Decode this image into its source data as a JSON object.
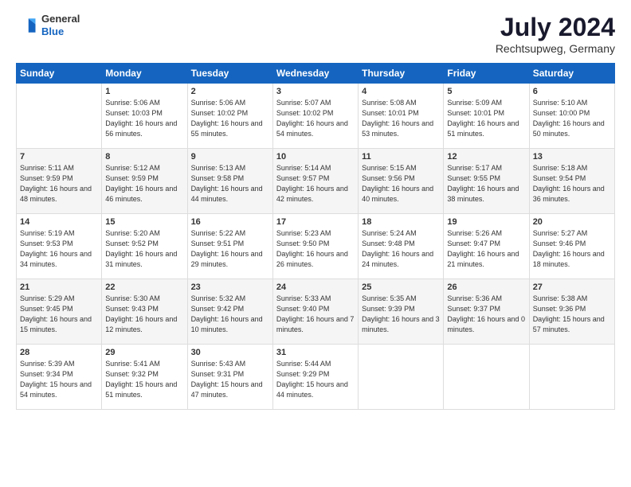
{
  "header": {
    "logo_general": "General",
    "logo_blue": "Blue",
    "month_title": "July 2024",
    "location": "Rechtsupweg, Germany"
  },
  "weekdays": [
    "Sunday",
    "Monday",
    "Tuesday",
    "Wednesday",
    "Thursday",
    "Friday",
    "Saturday"
  ],
  "weeks": [
    [
      {
        "day": "",
        "sunrise": "",
        "sunset": "",
        "daylight": ""
      },
      {
        "day": "1",
        "sunrise": "Sunrise: 5:06 AM",
        "sunset": "Sunset: 10:03 PM",
        "daylight": "Daylight: 16 hours and 56 minutes."
      },
      {
        "day": "2",
        "sunrise": "Sunrise: 5:06 AM",
        "sunset": "Sunset: 10:02 PM",
        "daylight": "Daylight: 16 hours and 55 minutes."
      },
      {
        "day": "3",
        "sunrise": "Sunrise: 5:07 AM",
        "sunset": "Sunset: 10:02 PM",
        "daylight": "Daylight: 16 hours and 54 minutes."
      },
      {
        "day": "4",
        "sunrise": "Sunrise: 5:08 AM",
        "sunset": "Sunset: 10:01 PM",
        "daylight": "Daylight: 16 hours and 53 minutes."
      },
      {
        "day": "5",
        "sunrise": "Sunrise: 5:09 AM",
        "sunset": "Sunset: 10:01 PM",
        "daylight": "Daylight: 16 hours and 51 minutes."
      },
      {
        "day": "6",
        "sunrise": "Sunrise: 5:10 AM",
        "sunset": "Sunset: 10:00 PM",
        "daylight": "Daylight: 16 hours and 50 minutes."
      }
    ],
    [
      {
        "day": "7",
        "sunrise": "Sunrise: 5:11 AM",
        "sunset": "Sunset: 9:59 PM",
        "daylight": "Daylight: 16 hours and 48 minutes."
      },
      {
        "day": "8",
        "sunrise": "Sunrise: 5:12 AM",
        "sunset": "Sunset: 9:59 PM",
        "daylight": "Daylight: 16 hours and 46 minutes."
      },
      {
        "day": "9",
        "sunrise": "Sunrise: 5:13 AM",
        "sunset": "Sunset: 9:58 PM",
        "daylight": "Daylight: 16 hours and 44 minutes."
      },
      {
        "day": "10",
        "sunrise": "Sunrise: 5:14 AM",
        "sunset": "Sunset: 9:57 PM",
        "daylight": "Daylight: 16 hours and 42 minutes."
      },
      {
        "day": "11",
        "sunrise": "Sunrise: 5:15 AM",
        "sunset": "Sunset: 9:56 PM",
        "daylight": "Daylight: 16 hours and 40 minutes."
      },
      {
        "day": "12",
        "sunrise": "Sunrise: 5:17 AM",
        "sunset": "Sunset: 9:55 PM",
        "daylight": "Daylight: 16 hours and 38 minutes."
      },
      {
        "day": "13",
        "sunrise": "Sunrise: 5:18 AM",
        "sunset": "Sunset: 9:54 PM",
        "daylight": "Daylight: 16 hours and 36 minutes."
      }
    ],
    [
      {
        "day": "14",
        "sunrise": "Sunrise: 5:19 AM",
        "sunset": "Sunset: 9:53 PM",
        "daylight": "Daylight: 16 hours and 34 minutes."
      },
      {
        "day": "15",
        "sunrise": "Sunrise: 5:20 AM",
        "sunset": "Sunset: 9:52 PM",
        "daylight": "Daylight: 16 hours and 31 minutes."
      },
      {
        "day": "16",
        "sunrise": "Sunrise: 5:22 AM",
        "sunset": "Sunset: 9:51 PM",
        "daylight": "Daylight: 16 hours and 29 minutes."
      },
      {
        "day": "17",
        "sunrise": "Sunrise: 5:23 AM",
        "sunset": "Sunset: 9:50 PM",
        "daylight": "Daylight: 16 hours and 26 minutes."
      },
      {
        "day": "18",
        "sunrise": "Sunrise: 5:24 AM",
        "sunset": "Sunset: 9:48 PM",
        "daylight": "Daylight: 16 hours and 24 minutes."
      },
      {
        "day": "19",
        "sunrise": "Sunrise: 5:26 AM",
        "sunset": "Sunset: 9:47 PM",
        "daylight": "Daylight: 16 hours and 21 minutes."
      },
      {
        "day": "20",
        "sunrise": "Sunrise: 5:27 AM",
        "sunset": "Sunset: 9:46 PM",
        "daylight": "Daylight: 16 hours and 18 minutes."
      }
    ],
    [
      {
        "day": "21",
        "sunrise": "Sunrise: 5:29 AM",
        "sunset": "Sunset: 9:45 PM",
        "daylight": "Daylight: 16 hours and 15 minutes."
      },
      {
        "day": "22",
        "sunrise": "Sunrise: 5:30 AM",
        "sunset": "Sunset: 9:43 PM",
        "daylight": "Daylight: 16 hours and 12 minutes."
      },
      {
        "day": "23",
        "sunrise": "Sunrise: 5:32 AM",
        "sunset": "Sunset: 9:42 PM",
        "daylight": "Daylight: 16 hours and 10 minutes."
      },
      {
        "day": "24",
        "sunrise": "Sunrise: 5:33 AM",
        "sunset": "Sunset: 9:40 PM",
        "daylight": "Daylight: 16 hours and 7 minutes."
      },
      {
        "day": "25",
        "sunrise": "Sunrise: 5:35 AM",
        "sunset": "Sunset: 9:39 PM",
        "daylight": "Daylight: 16 hours and 3 minutes."
      },
      {
        "day": "26",
        "sunrise": "Sunrise: 5:36 AM",
        "sunset": "Sunset: 9:37 PM",
        "daylight": "Daylight: 16 hours and 0 minutes."
      },
      {
        "day": "27",
        "sunrise": "Sunrise: 5:38 AM",
        "sunset": "Sunset: 9:36 PM",
        "daylight": "Daylight: 15 hours and 57 minutes."
      }
    ],
    [
      {
        "day": "28",
        "sunrise": "Sunrise: 5:39 AM",
        "sunset": "Sunset: 9:34 PM",
        "daylight": "Daylight: 15 hours and 54 minutes."
      },
      {
        "day": "29",
        "sunrise": "Sunrise: 5:41 AM",
        "sunset": "Sunset: 9:32 PM",
        "daylight": "Daylight: 15 hours and 51 minutes."
      },
      {
        "day": "30",
        "sunrise": "Sunrise: 5:43 AM",
        "sunset": "Sunset: 9:31 PM",
        "daylight": "Daylight: 15 hours and 47 minutes."
      },
      {
        "day": "31",
        "sunrise": "Sunrise: 5:44 AM",
        "sunset": "Sunset: 9:29 PM",
        "daylight": "Daylight: 15 hours and 44 minutes."
      },
      {
        "day": "",
        "sunrise": "",
        "sunset": "",
        "daylight": ""
      },
      {
        "day": "",
        "sunrise": "",
        "sunset": "",
        "daylight": ""
      },
      {
        "day": "",
        "sunrise": "",
        "sunset": "",
        "daylight": ""
      }
    ]
  ]
}
